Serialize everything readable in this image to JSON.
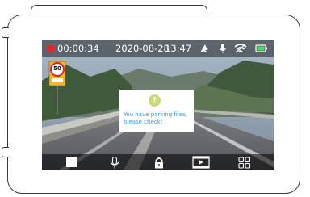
{
  "status_bar": {
    "recording_time": "00:00:34",
    "date": "2020-08-28",
    "clock": "13:47",
    "icons": [
      "record-dot-icon",
      "parking-mode-icon",
      "microphone-icon",
      "wifi-icon",
      "battery-icon"
    ]
  },
  "road_sign": {
    "speed_limit": "50"
  },
  "dialog": {
    "icon": "!",
    "message": "You have parking files, please check!"
  },
  "bottom_bar": {
    "buttons": [
      "stop-record-button",
      "microphone-button",
      "lock-button",
      "playback-button",
      "menu-grid-button"
    ]
  },
  "colors": {
    "recording": "#e8262a",
    "battery": "#4cd964",
    "dialog_text": "#2d9fd6",
    "dialog_icon": "#cdd878"
  }
}
